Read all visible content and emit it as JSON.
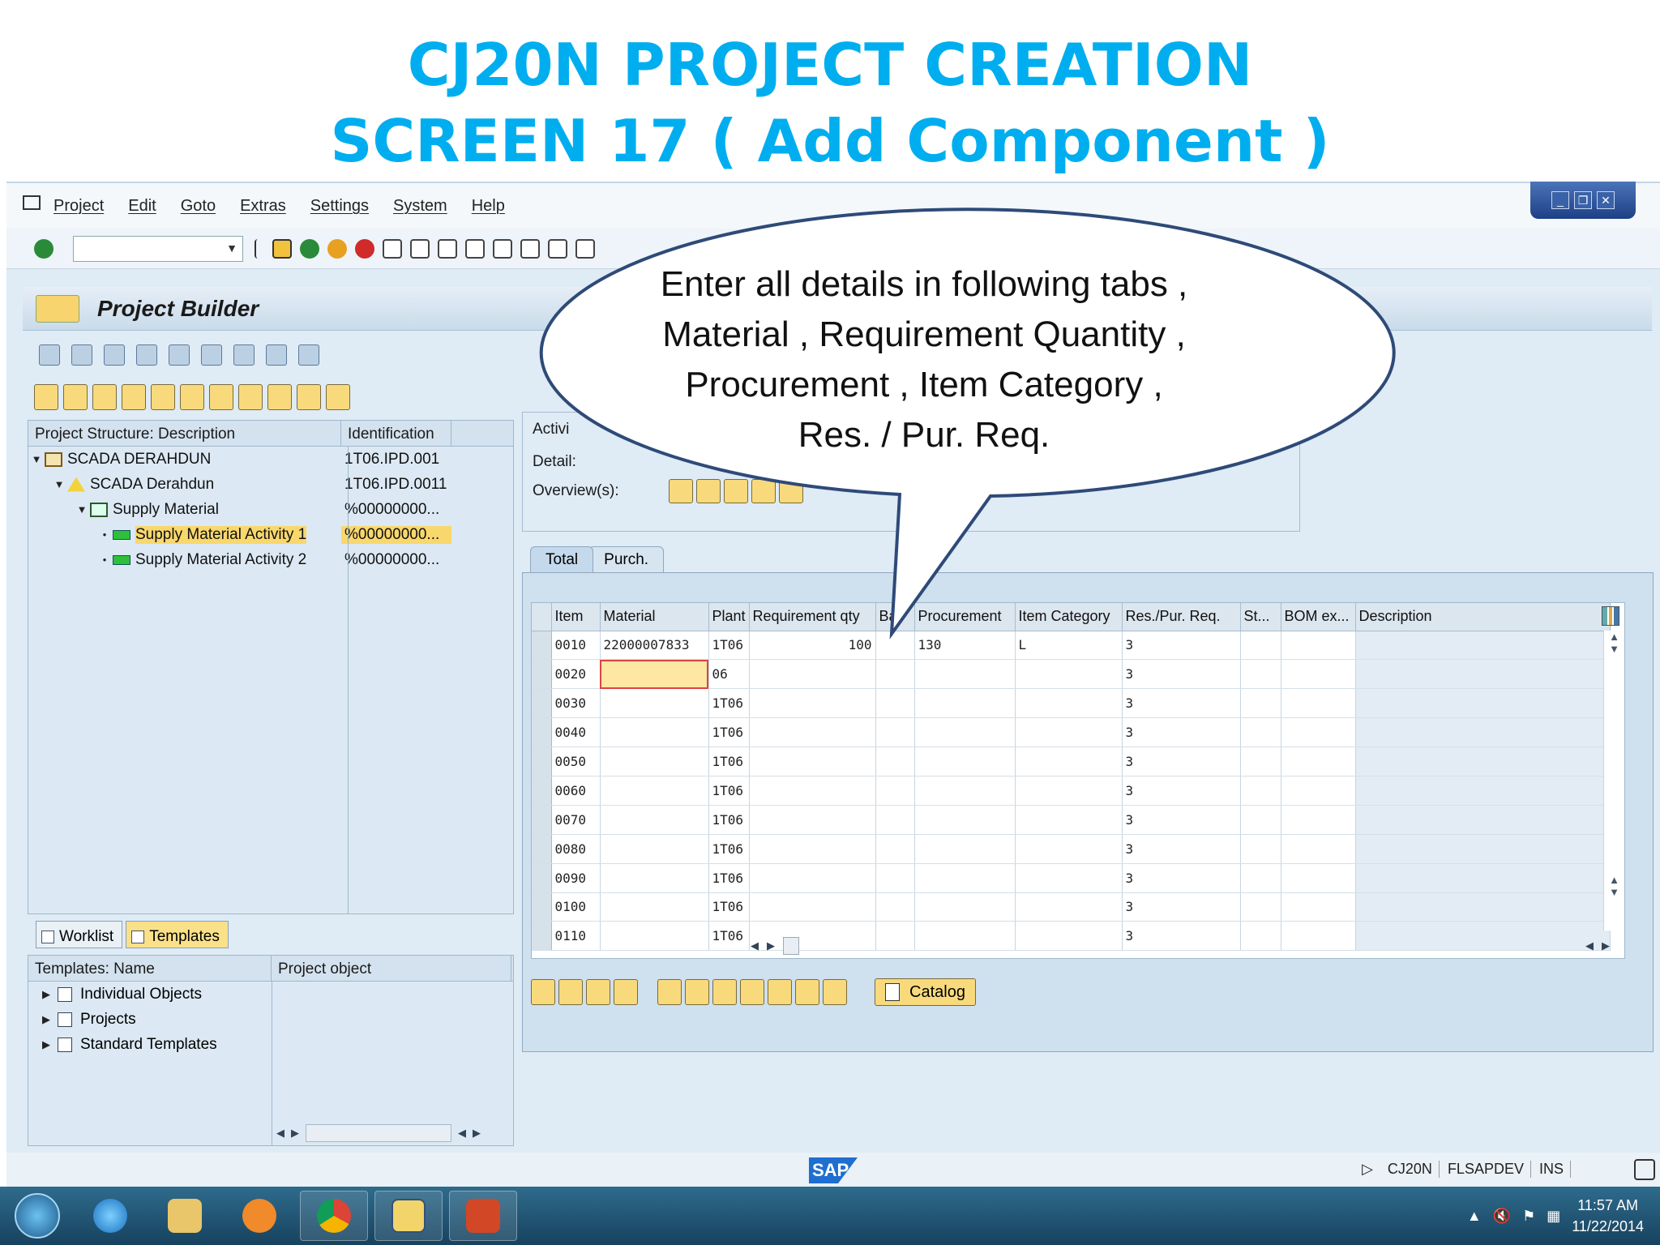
{
  "slide": {
    "title_line1": "CJ20N PROJECT CREATION",
    "title_line2": "SCREEN 17 ( Add Component )"
  },
  "callout": {
    "line1": "Enter all details in following tabs ,",
    "line2": "Material , Requirement Quantity ,",
    "line3": "Procurement , Item Category ,",
    "line4": "Res. / Pur. Req."
  },
  "menu": {
    "items": [
      "Project",
      "Edit",
      "Goto",
      "Extras",
      "Settings",
      "System",
      "Help"
    ]
  },
  "app": {
    "title": "Project Builder"
  },
  "structure_tree": {
    "col_description": "Project Structure: Description",
    "col_identification": "Identification",
    "rows": [
      {
        "label": "SCADA DERAHDUN",
        "id": "1T06.IPD.001"
      },
      {
        "label": "SCADA Derahdun",
        "id": "1T06.IPD.0011"
      },
      {
        "label": "Supply Material",
        "id": "%00000000..."
      },
      {
        "label": "Supply Material Activity 1",
        "id": "%00000000..."
      },
      {
        "label": "Supply Material Activity 2",
        "id": "%00000000..."
      }
    ]
  },
  "lower_tabs": {
    "worklist": "Worklist",
    "templates": "Templates"
  },
  "templates_tree": {
    "col_name": "Templates: Name",
    "col_object": "Project object",
    "rows": [
      "Individual Objects",
      "Projects",
      "Standard Templates"
    ]
  },
  "detail": {
    "activity_label": "Activi",
    "detail_label": "Detail:",
    "overview_label": "Overview(s):"
  },
  "component_tabs": {
    "total": "Total",
    "purch": "Purch."
  },
  "grid": {
    "headers": [
      "Item",
      "Material",
      "Plant",
      "Requirement qty",
      "Ba",
      "Procurement",
      "Item Category",
      "Res./Pur. Req.",
      "St...",
      "BOM ex...",
      "Description"
    ],
    "rows": [
      {
        "item": "0010",
        "material": "22000007833",
        "plant": "1T06",
        "qty": "100",
        "procurement": "130",
        "category": "L",
        "res": "3"
      },
      {
        "item": "0020",
        "material": "",
        "plant": "06",
        "qty": "",
        "procurement": "",
        "category": "",
        "res": "3"
      },
      {
        "item": "0030",
        "material": "",
        "plant": "1T06",
        "qty": "",
        "procurement": "",
        "category": "",
        "res": "3"
      },
      {
        "item": "0040",
        "material": "",
        "plant": "1T06",
        "qty": "",
        "procurement": "",
        "category": "",
        "res": "3"
      },
      {
        "item": "0050",
        "material": "",
        "plant": "1T06",
        "qty": "",
        "procurement": "",
        "category": "",
        "res": "3"
      },
      {
        "item": "0060",
        "material": "",
        "plant": "1T06",
        "qty": "",
        "procurement": "",
        "category": "",
        "res": "3"
      },
      {
        "item": "0070",
        "material": "",
        "plant": "1T06",
        "qty": "",
        "procurement": "",
        "category": "",
        "res": "3"
      },
      {
        "item": "0080",
        "material": "",
        "plant": "1T06",
        "qty": "",
        "procurement": "",
        "category": "",
        "res": "3"
      },
      {
        "item": "0090",
        "material": "",
        "plant": "1T06",
        "qty": "",
        "procurement": "",
        "category": "",
        "res": "3"
      },
      {
        "item": "0100",
        "material": "",
        "plant": "1T06",
        "qty": "",
        "procurement": "",
        "category": "",
        "res": "3"
      },
      {
        "item": "0110",
        "material": "",
        "plant": "1T06",
        "qty": "",
        "procurement": "",
        "category": "",
        "res": "3"
      }
    ]
  },
  "catalog_button": "Catalog",
  "status": {
    "logo": "SAP",
    "transaction": "CJ20N",
    "system": "FLSAPDEV",
    "mode": "INS"
  },
  "taskbar": {
    "time": "11:57 AM",
    "date": "11/22/2014"
  },
  "colors": {
    "title": "#00aeef",
    "callout_fill": "#ffffff",
    "callout_stroke": "#2e4a78",
    "selection": "#f8d76d"
  }
}
